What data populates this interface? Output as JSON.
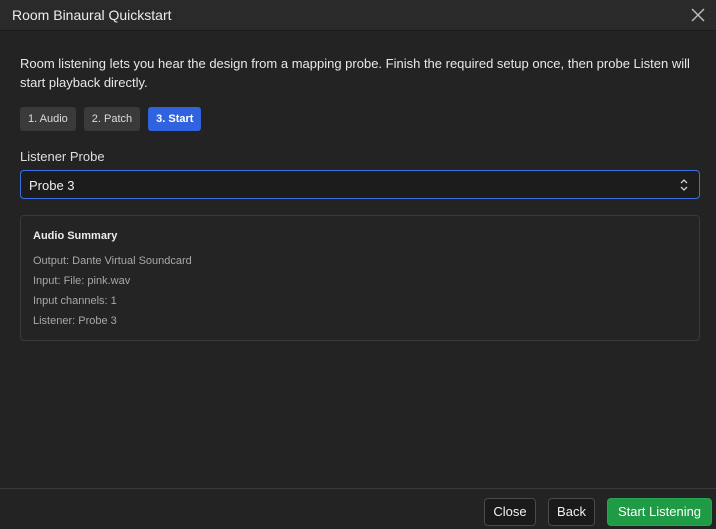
{
  "window": {
    "title": "Room Binaural Quickstart",
    "close_icon": "close-icon"
  },
  "intro": {
    "text": "Room listening lets you hear the design from a mapping probe. Finish the required setup once, then probe Listen will start playback directly."
  },
  "steps": [
    {
      "label": "1. Audio",
      "active": false
    },
    {
      "label": "2. Patch",
      "active": false
    },
    {
      "label": "3. Start",
      "active": true
    }
  ],
  "probe": {
    "label": "Listener Probe",
    "selected": "Probe 3",
    "chevron_icon": "chevron-updown-icon"
  },
  "summary": {
    "title": "Audio Summary",
    "lines": [
      "Output: Dante Virtual Soundcard",
      "Input: File: pink.wav",
      "Input channels: 1",
      "Listener: Probe 3"
    ]
  },
  "footer": {
    "close_label": "Close",
    "back_label": "Back",
    "start_label": "Start Listening"
  },
  "colors": {
    "background": "#232323",
    "accent": "#2f63df",
    "primary_action": "#1f9a45"
  }
}
